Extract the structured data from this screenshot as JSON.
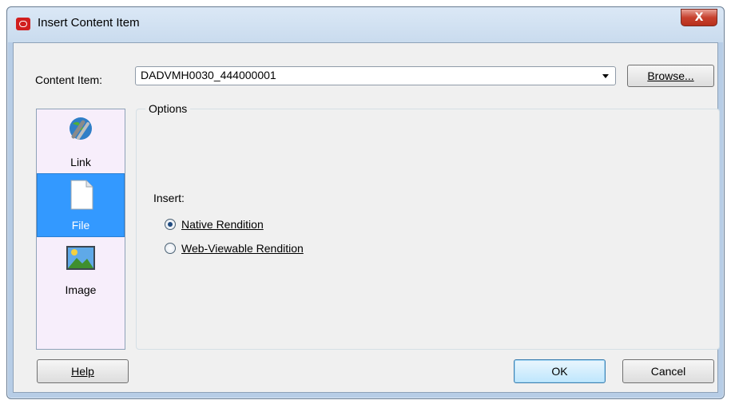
{
  "window": {
    "title": "Insert Content Item",
    "close_glyph": "X"
  },
  "content_item": {
    "label": "Content Item:",
    "value": "DADVMH0030_444000001",
    "browse_label": "Browse..."
  },
  "sidebar": {
    "items": [
      {
        "label": "Link",
        "icon": "link-globe-icon",
        "selected": false
      },
      {
        "label": "File",
        "icon": "file-icon",
        "selected": true
      },
      {
        "label": "Image",
        "icon": "image-icon",
        "selected": false
      }
    ]
  },
  "options": {
    "group_label": "Options",
    "insert_label": "Insert:",
    "radios": [
      {
        "label": "Native Rendition",
        "checked": true
      },
      {
        "label": "Web-Viewable Rendition",
        "checked": false
      }
    ]
  },
  "buttons": {
    "help": "Help",
    "ok": "OK",
    "cancel": "Cancel"
  },
  "colors": {
    "selection": "#3399ff",
    "sidebar_bg": "#f7eefb",
    "app_icon": "#d11f1f",
    "close_button": "#c7412e"
  }
}
